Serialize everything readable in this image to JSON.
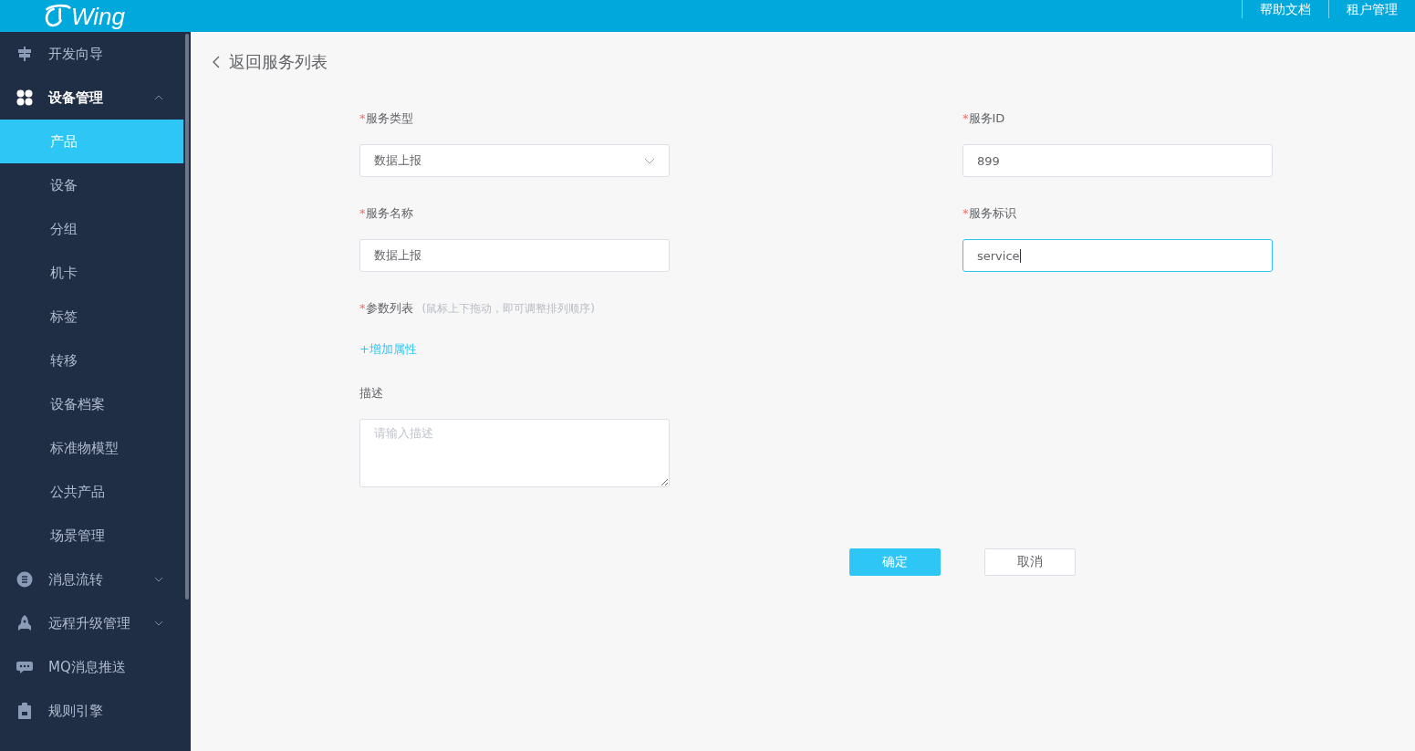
{
  "header": {
    "logo": "Wing",
    "links": [
      "帮助文档",
      "租户管理"
    ]
  },
  "sidebar": {
    "items": [
      {
        "label": "开发向导",
        "kind": "link",
        "selected": false
      },
      {
        "label": "设备管理",
        "kind": "group",
        "expanded": true,
        "selected": false,
        "children": [
          {
            "label": "产品",
            "selected": true
          },
          {
            "label": "设备",
            "selected": false
          },
          {
            "label": "分组",
            "selected": false
          },
          {
            "label": "机卡",
            "selected": false
          },
          {
            "label": "标签",
            "selected": false
          },
          {
            "label": "转移",
            "selected": false
          },
          {
            "label": "设备档案",
            "selected": false
          },
          {
            "label": "标准物模型",
            "selected": false
          },
          {
            "label": "公共产品",
            "selected": false
          },
          {
            "label": "场景管理",
            "selected": false
          }
        ]
      },
      {
        "label": "消息流转",
        "kind": "group",
        "expanded": false,
        "selected": false
      },
      {
        "label": "远程升级管理",
        "kind": "group",
        "expanded": false,
        "selected": false
      },
      {
        "label": "MQ消息推送",
        "kind": "link",
        "selected": false
      },
      {
        "label": "规则引擎",
        "kind": "link",
        "selected": false
      }
    ]
  },
  "back_link": "返回服务列表",
  "form": {
    "rows": [
      [
        {
          "kind": "select",
          "label": "服务类型",
          "required_mark": "*",
          "value": "数据上报",
          "focused": false
        },
        {
          "kind": "input",
          "label": "服务ID",
          "required_mark": "*",
          "value": "899",
          "focused": false
        }
      ],
      [
        {
          "kind": "input",
          "label": "服务名称",
          "required_mark": "*",
          "value": "数据上报",
          "focused": false
        },
        {
          "kind": "input",
          "label": "服务标识",
          "required_mark": "*",
          "value": "service",
          "focused": true
        }
      ]
    ],
    "params": {
      "label": "参数列表",
      "required_mark": "*",
      "hint": "(鼠标上下拖动，即可调整排列顺序)",
      "add_link": "+增加属性"
    },
    "description": {
      "label": "描述",
      "placeholder": "请输入描述"
    }
  },
  "buttons": [
    {
      "label": "确定",
      "kind": "primary"
    },
    {
      "label": "取消",
      "kind": "default"
    }
  ]
}
